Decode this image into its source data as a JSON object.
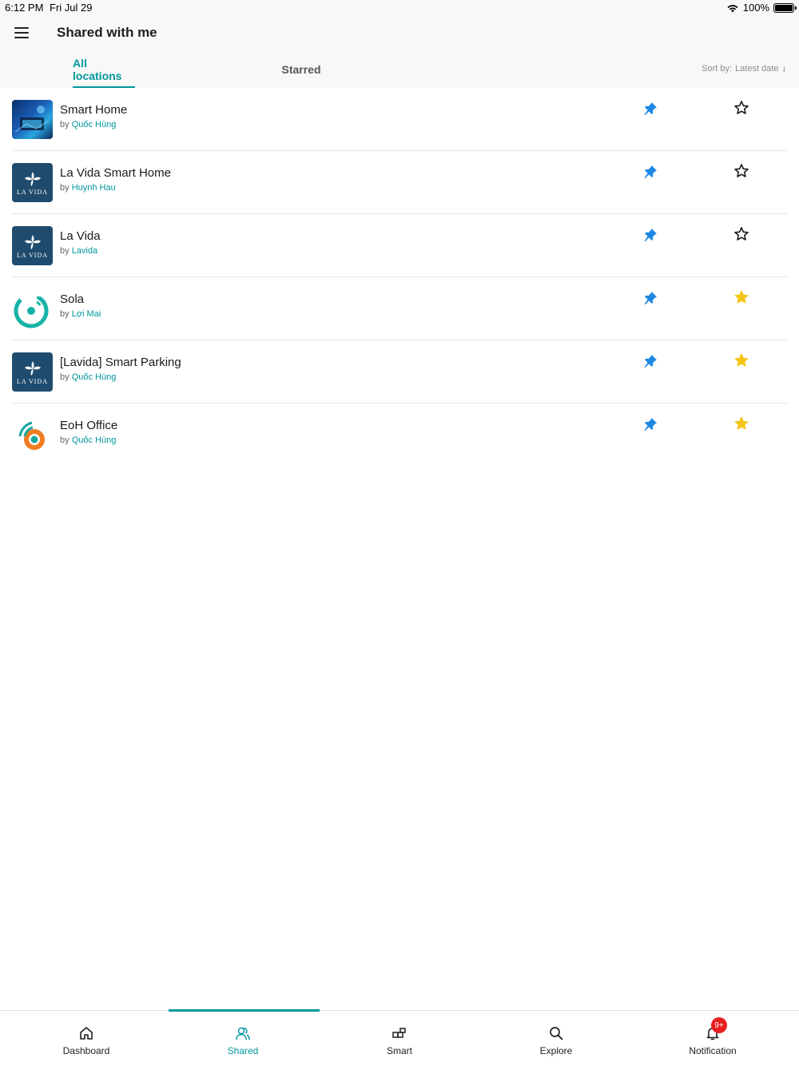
{
  "status_bar": {
    "time": "6:12 PM",
    "date": "Fri Jul 29",
    "battery": "100%"
  },
  "header": {
    "title": "Shared with me"
  },
  "tabs": [
    {
      "label": "All locations"
    },
    {
      "label": "Starred"
    }
  ],
  "sort": {
    "label": "Sort by:",
    "value": "Latest date"
  },
  "locations": [
    {
      "title": "Smart Home",
      "by": "by",
      "owner": "Quốc Hùng",
      "starred": false
    },
    {
      "title": "La Vida Smart Home",
      "by": "by",
      "owner": "Huynh Hau",
      "starred": false
    },
    {
      "title": "La Vida",
      "by": "by",
      "owner": "Lavida",
      "starred": false
    },
    {
      "title": "Sola",
      "by": "by",
      "owner": "Lợi Mai",
      "starred": true
    },
    {
      "title": "[Lavida] Smart Parking",
      "by": "by",
      "owner": "Quốc Hùng",
      "starred": true
    },
    {
      "title": "EoH Office",
      "by": "by",
      "owner": "Quốc Hùng",
      "starred": true
    }
  ],
  "lavida_logo_text": "LA VIDA",
  "nav": [
    {
      "label": "Dashboard",
      "icon": "home-icon"
    },
    {
      "label": "Shared",
      "icon": "shared-users-icon"
    },
    {
      "label": "Smart",
      "icon": "smart-blocks-icon"
    },
    {
      "label": "Explore",
      "icon": "search-icon"
    },
    {
      "label": "Notification",
      "icon": "bell-icon",
      "badge": "9+"
    }
  ],
  "colors": {
    "accent": "#00979d",
    "pin": "#1e88e5",
    "star_filled": "#f5c518",
    "badge": "#e81f1f"
  }
}
